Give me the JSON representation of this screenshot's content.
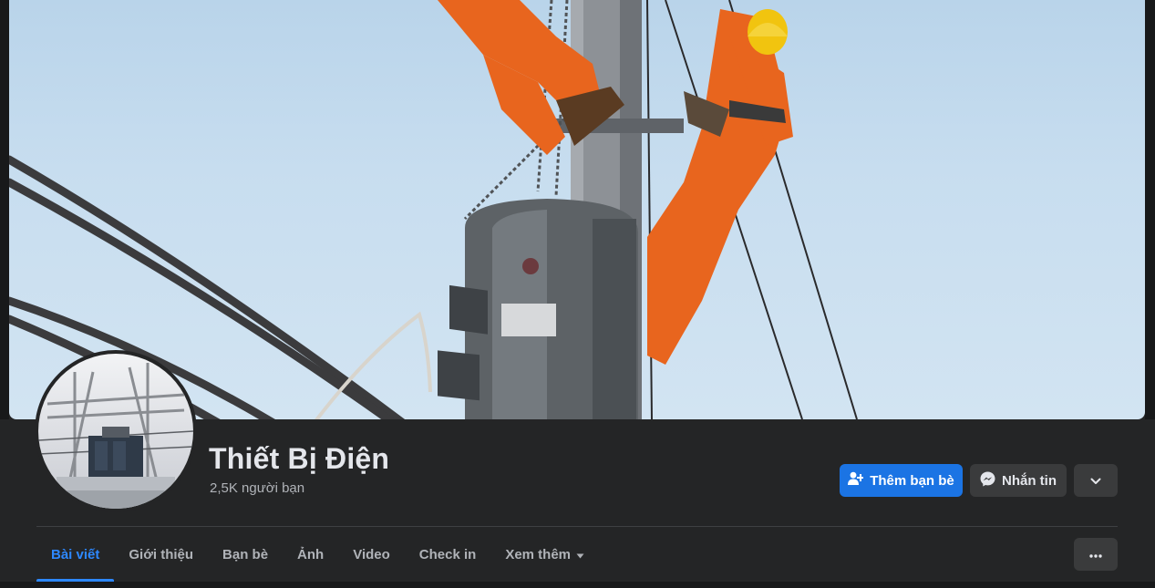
{
  "profile": {
    "name": "Thiết Bị Điện",
    "friends_count": "2,5K người bạn"
  },
  "actions": {
    "add_friend_label": "Thêm bạn bè",
    "message_label": "Nhắn tin"
  },
  "tabs": [
    {
      "label": "Bài viết",
      "active": true
    },
    {
      "label": "Giới thiệu",
      "active": false
    },
    {
      "label": "Bạn bè",
      "active": false
    },
    {
      "label": "Ảnh",
      "active": false
    },
    {
      "label": "Video",
      "active": false
    },
    {
      "label": "Check in",
      "active": false
    },
    {
      "label": "Xem thêm",
      "active": false
    }
  ],
  "icons": {
    "add_friend": "add-friend-icon",
    "messenger": "messenger-icon",
    "more_actions": "chevron-down-icon",
    "more_tab": "caret-down-icon",
    "tab_options": "ellipsis-icon"
  },
  "colors": {
    "primary": "#1b74e4",
    "active_tab": "#2d88ff",
    "card_bg": "#242526",
    "page_bg": "#18191a",
    "button_bg": "#3a3b3c",
    "worker_suit": "#e8651e",
    "helmet": "#f1c40f"
  }
}
